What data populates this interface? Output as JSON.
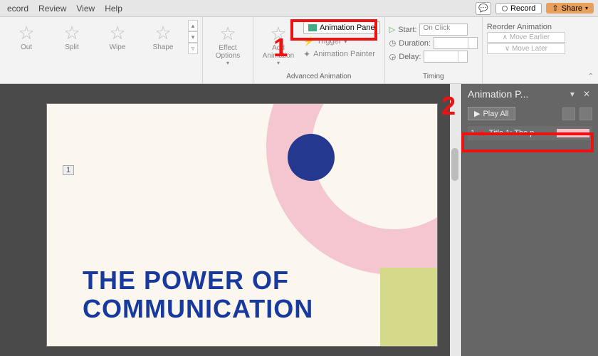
{
  "titlebar": {
    "menus": [
      "ecord",
      "Review",
      "View",
      "Help"
    ],
    "record_label": "Record",
    "share_label": "Share"
  },
  "ribbon": {
    "gallery": [
      {
        "label": "Out"
      },
      {
        "label": "Split"
      },
      {
        "label": "Wipe"
      },
      {
        "label": "Shape"
      }
    ],
    "effect_options": "Effect\nOptions",
    "add_animation": "Add\nAnimation",
    "animation_pane": "Animation Pane",
    "trigger": "Trigger",
    "animation_painter": "Animation Painter",
    "group_advanced": "Advanced Animation",
    "start": "Start:",
    "start_value": "On Click",
    "duration": "Duration:",
    "delay": "Delay:",
    "group_timing": "Timing",
    "reorder_title": "Reorder Animation",
    "move_earlier": "Move Earlier",
    "move_later": "Move Later"
  },
  "slide": {
    "indicator": "1",
    "title_line1": "THE POWER OF",
    "title_line2": "COMMUNICATION"
  },
  "side_panel": {
    "title": "Animation P...",
    "play_all": "Play All",
    "item_num": "1",
    "item_label": "Title 1: The p..."
  },
  "annotations": {
    "one": "1",
    "two": "2"
  }
}
